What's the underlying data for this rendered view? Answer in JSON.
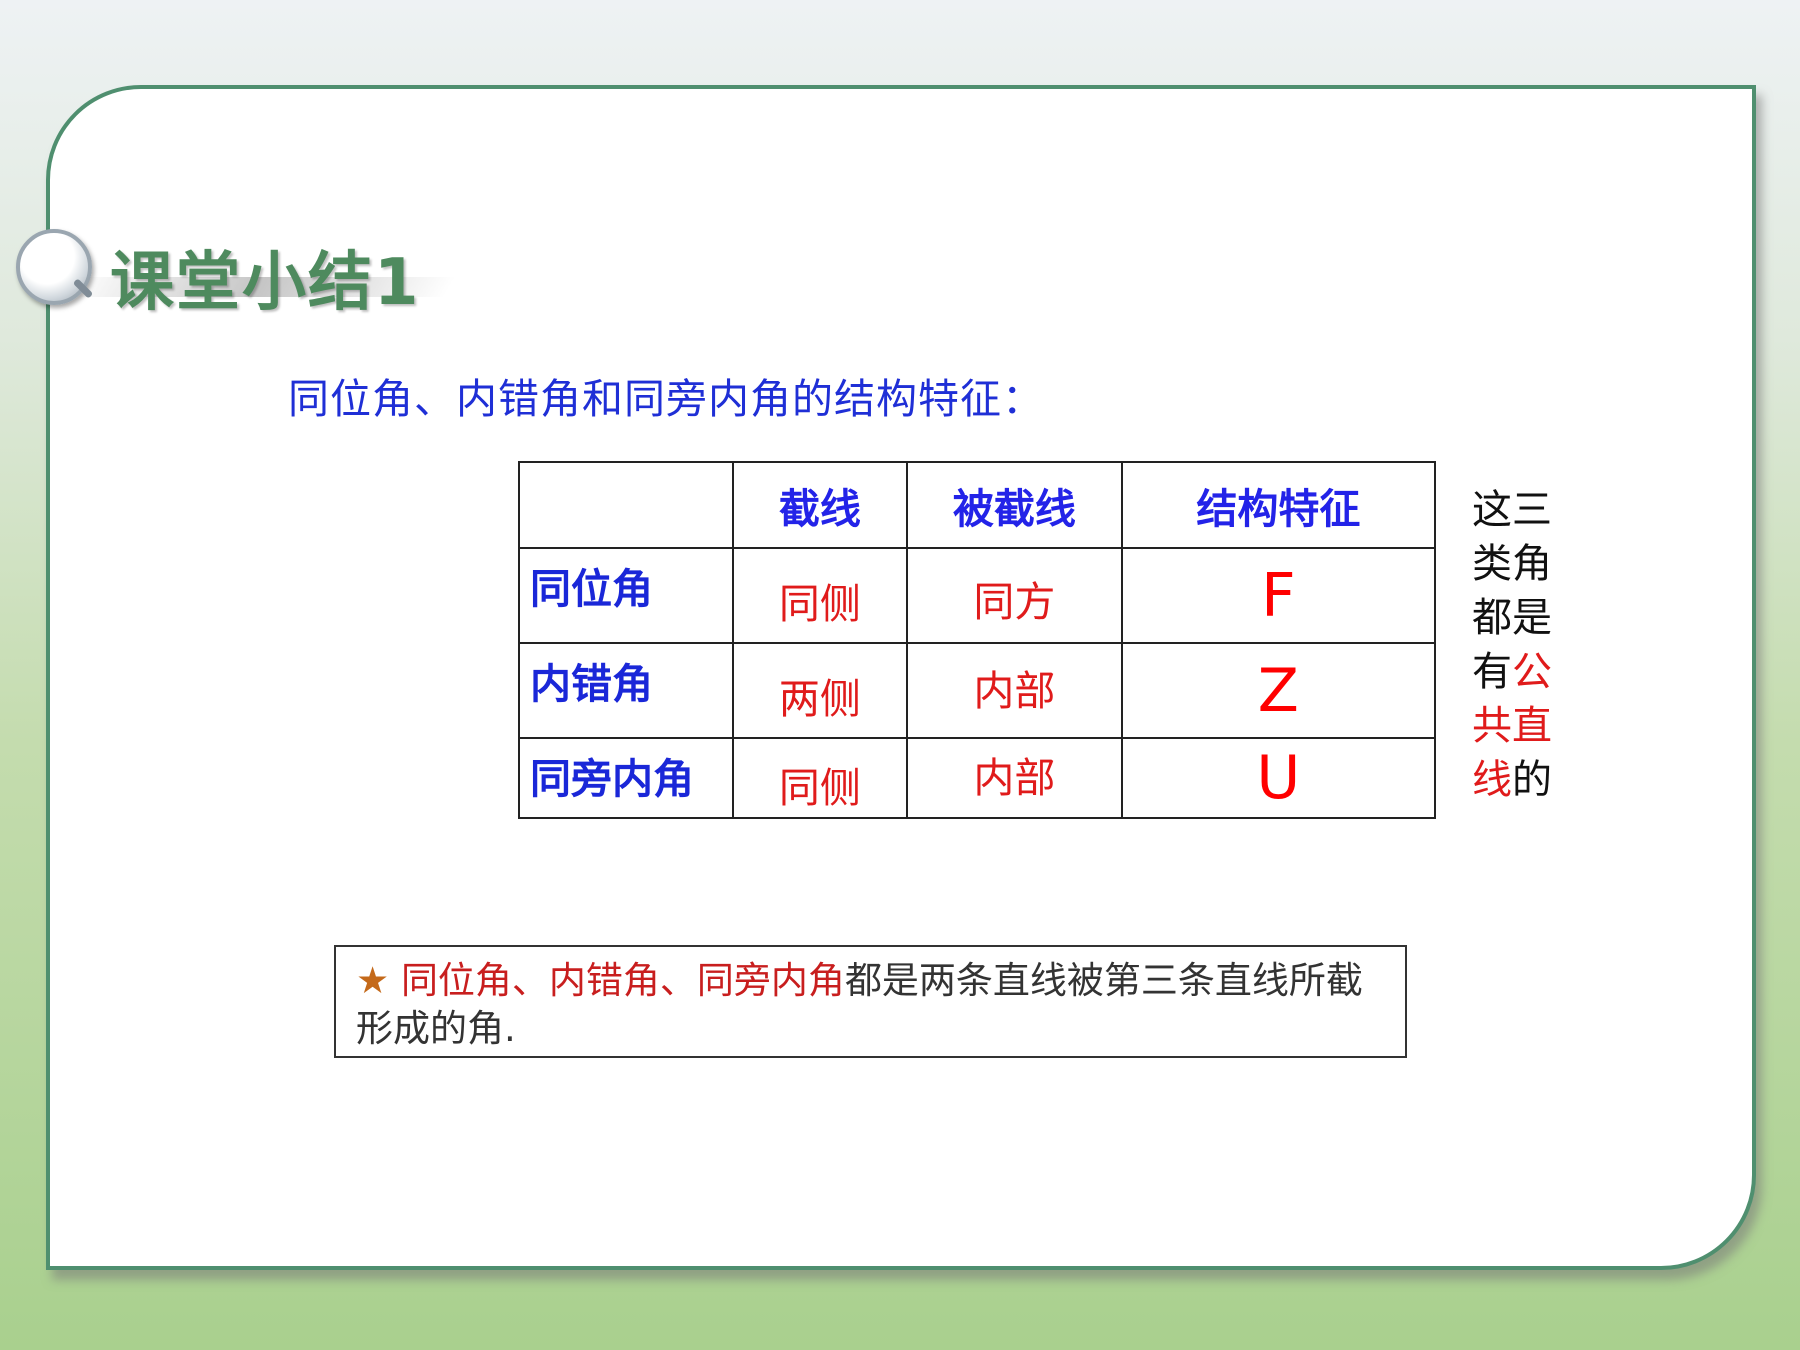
{
  "title": "课堂小结1",
  "subtitle": "同位角、内错角和同旁内角的结构特征：",
  "table": {
    "headers": [
      "",
      "截线",
      "被截线",
      "结构特征"
    ],
    "rows": [
      {
        "label": "同位角",
        "cutting_line": "同侧",
        "cut_lines": "同方",
        "feature": "F"
      },
      {
        "label": "内错角",
        "cutting_line": "两侧",
        "cut_lines": "内部",
        "feature": "Z"
      },
      {
        "label": "同旁内角",
        "cutting_line": "同侧",
        "cut_lines": "内部",
        "feature": "U"
      }
    ]
  },
  "side_note": {
    "part1": "这三类角都是有",
    "part2_red": "公共直线",
    "part3": "的"
  },
  "note": {
    "star": "★",
    "red_text": "同位角、内错角、同旁内角",
    "text": "都是两条直线被第三条直线所截形成的角."
  },
  "colors": {
    "title_green": "#4e8a5e",
    "blue": "#1f2fd6",
    "red": "#e01b1b",
    "star_orange": "#c4691a",
    "frame_green": "#4f8f6f"
  }
}
